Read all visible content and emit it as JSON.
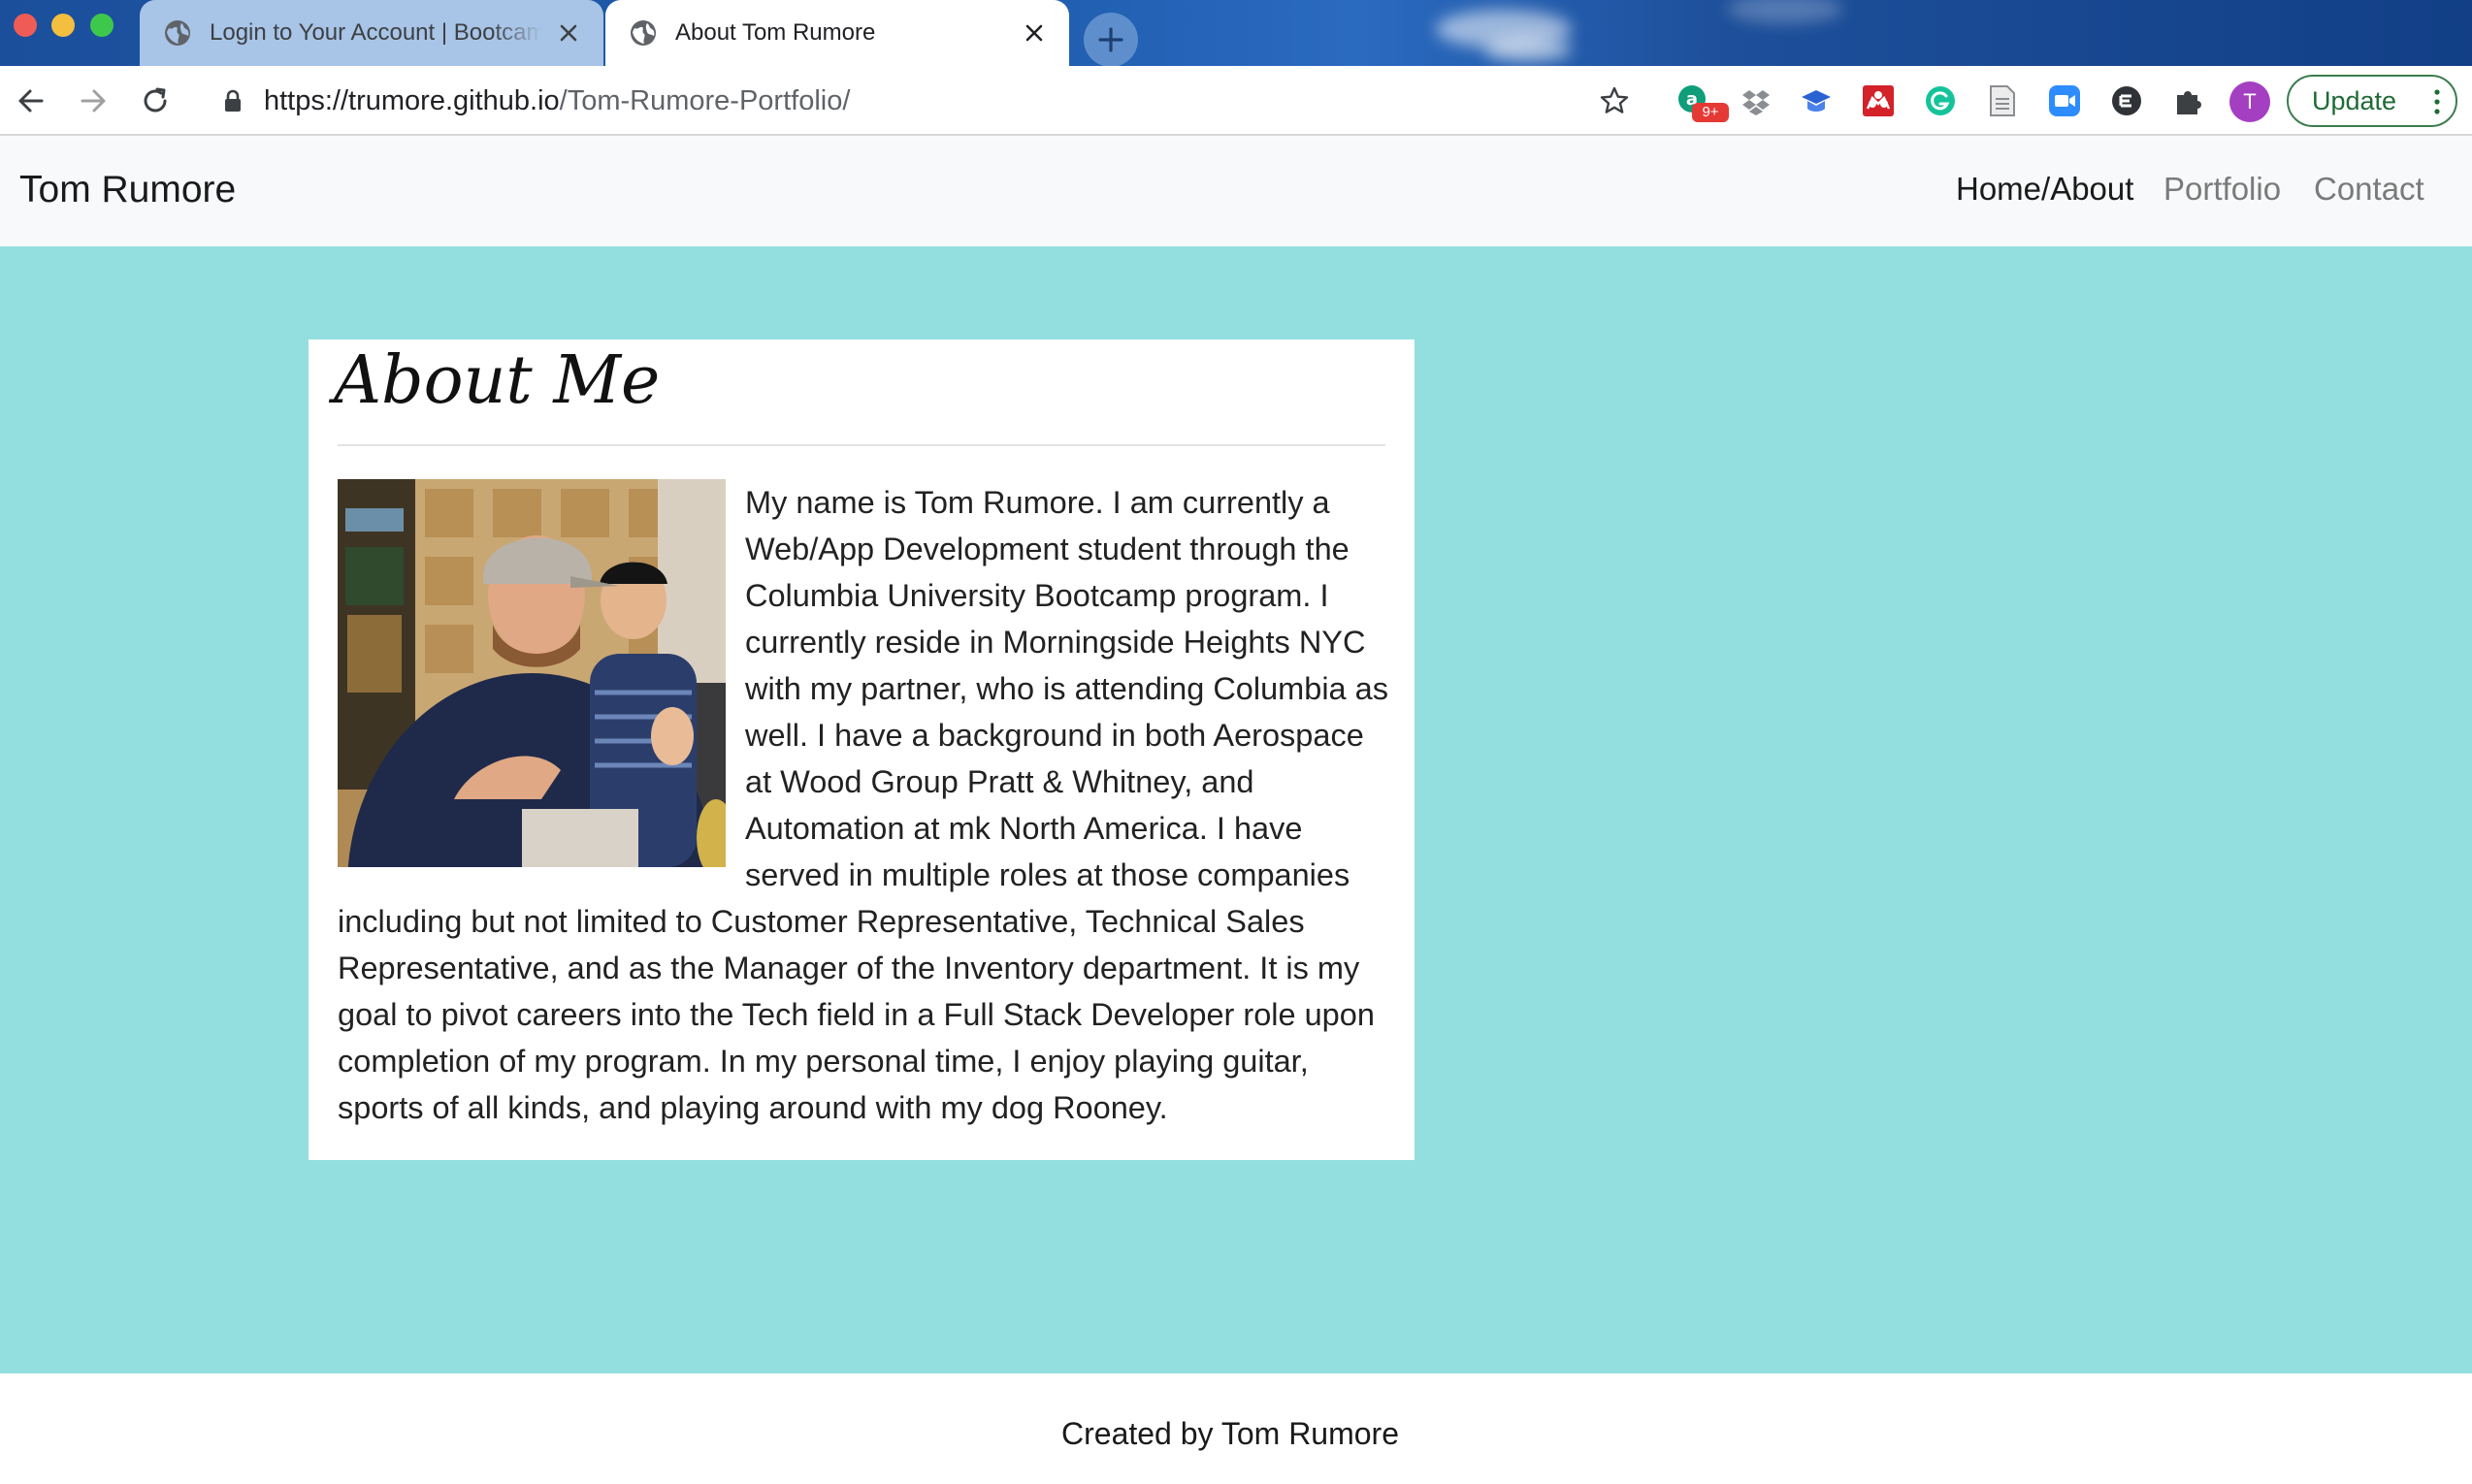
{
  "browser": {
    "tabs": [
      {
        "title": "Login to Your Account | Bootcamp Spot",
        "active": false
      },
      {
        "title": "About Tom Rumore",
        "active": true
      }
    ],
    "url_host": "https://trumore.github.io",
    "url_path": "/Tom-Rumore-Portfolio/",
    "update_label": "Update",
    "profile_initial": "T",
    "extension_badge": "9+",
    "extensions": [
      "grammarly-apps-icon",
      "dropbox-icon",
      "graduation-cap-icon",
      "mendeley-icon",
      "grammarly-icon",
      "document-icon",
      "zoom-icon",
      "eyeo-icon",
      "puzzle-icon"
    ]
  },
  "site": {
    "brand": "Tom Rumore",
    "nav": [
      {
        "label": "Home/About",
        "active": true
      },
      {
        "label": "Portfolio",
        "active": false
      },
      {
        "label": "Contact",
        "active": false
      }
    ],
    "about": {
      "heading": "About Me",
      "body": "My name is Tom Rumore. I am currently a Web/App Development student through the Columbia University Bootcamp program. I currently reside in Morningside Heights NYC with my partner, who is attending Columbia as well. I have a background in both Aerospace at Wood Group Pratt & Whitney, and Automation at mk North America. I have served in multiple roles at those companies including but not limited to Customer Representative, Technical Sales Representative, and as the Manager of the Inventory department. It is my goal to pivot careers into the Tech field in a Full Stack Developer role upon completion of my program. In my personal time, I enjoy playing guitar, sports of all kinds, and playing around with my dog Rooney."
    },
    "footer": "Created by Tom Rumore"
  },
  "colors": {
    "page_background": "#93dfe0",
    "navbar_background": "#f8f9fa",
    "card_background": "#ffffff",
    "update_button": "#1e6b34",
    "avatar": "#a43fc2"
  }
}
